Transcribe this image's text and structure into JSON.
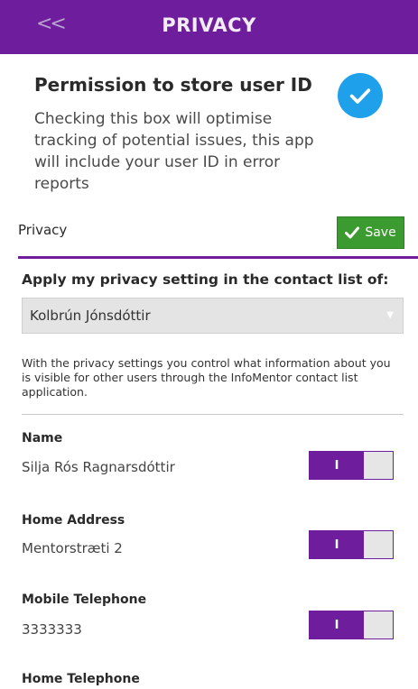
{
  "header": {
    "back_label": "<<",
    "title": "PRIVACY"
  },
  "permission": {
    "title": "Permission to store user ID",
    "description": "Checking this box will optimise tracking of potential issues, this app will include your user ID in error reports",
    "checked": true,
    "check_color": "#1ea0ea"
  },
  "privacy_bar": {
    "label": "Privacy",
    "save_label": "Save"
  },
  "apply": {
    "label": "Apply my privacy setting in the contact list of:",
    "selected": "Kolbrún Jónsdóttir"
  },
  "info_text": "With the privacy settings you control what information about you is visible for other users through the InfoMentor contact list application.",
  "fields": [
    {
      "label": "Name",
      "value": "Silja Rós Ragnarsdóttir",
      "toggle_label": "I",
      "on": true
    },
    {
      "label": "Home Address",
      "value": "Mentorstræti 2",
      "toggle_label": "I",
      "on": true
    },
    {
      "label": "Mobile Telephone",
      "value": "3333333",
      "toggle_label": "I",
      "on": true
    },
    {
      "label": "Home Telephone"
    }
  ],
  "colors": {
    "brand": "#6e1d9c",
    "save": "#3c9b30",
    "check": "#1ea0ea"
  }
}
